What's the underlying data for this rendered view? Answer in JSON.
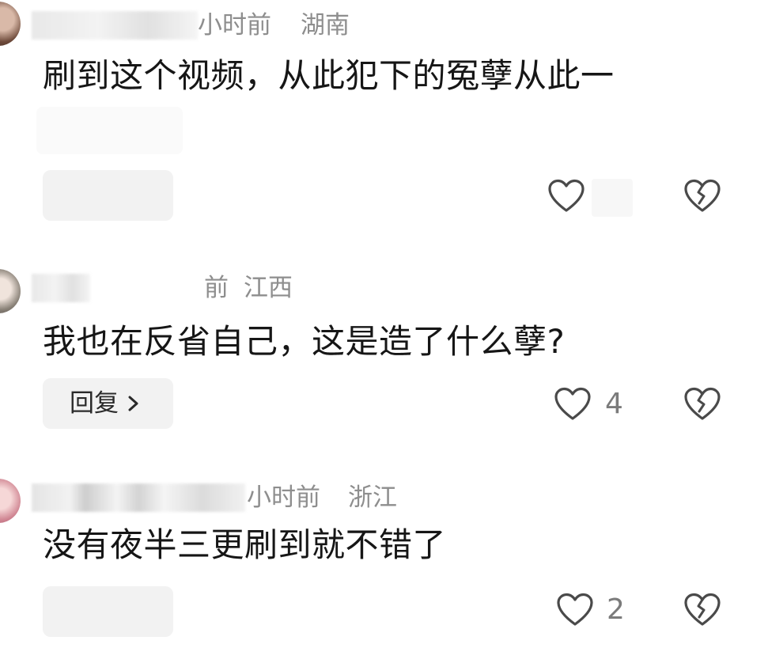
{
  "comments": [
    {
      "meta_time": "小时前",
      "meta_region": "湖南",
      "text": "刷到这个视频，从此犯下的冤孽从此一",
      "like_count": "",
      "reply_label": "",
      "icons": {
        "like": "heart-outline-icon",
        "dislike": "broken-heart-icon"
      }
    },
    {
      "meta_time": "前",
      "meta_region": "江西",
      "text": "我也在反省自己，这是造了什么孽?",
      "like_count": "4",
      "reply_label": "回复",
      "icons": {
        "like": "heart-outline-icon",
        "dislike": "broken-heart-icon",
        "reply": "chevron-right-icon"
      }
    },
    {
      "meta_time": "小时前",
      "meta_region": "浙江",
      "text": "没有夜半三更刷到就不错了",
      "like_count": "2",
      "reply_label": "",
      "icons": {
        "like": "heart-outline-icon",
        "dislike": "broken-heart-icon"
      }
    }
  ],
  "colors": {
    "text_primary": "#161616",
    "text_meta": "#8e8e8e",
    "icon_stroke": "#4a4a4a",
    "chip_bg": "#f2f2f2"
  }
}
